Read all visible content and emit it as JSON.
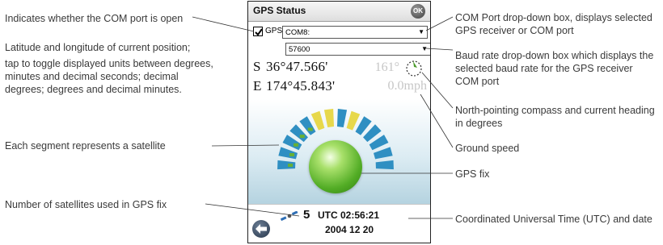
{
  "device": {
    "title": "GPS Status",
    "ok_label": "OK",
    "gps_checkbox_label": "GPS",
    "gps_checked": true,
    "com_port": "COM8:",
    "baud_rate": "57600",
    "latitude": {
      "hemisphere": "S",
      "value": "36°47.566'"
    },
    "longitude": {
      "hemisphere": "E",
      "value": "174°45.843'"
    },
    "heading": "161°",
    "speed": "0.0mph",
    "satellites_used": "5",
    "utc_time": "UTC 02:56:21",
    "utc_date": "2004 12 20",
    "colors": {
      "accent_blue": "#2f8fc2",
      "signal_yellow": "#e7d84b",
      "signal_green": "#67b035",
      "fix_green": "#52ac25"
    }
  },
  "annotations": {
    "com_open": "Indicates whether the COM port is open",
    "lat_lon": "Latitude and longitude of current position;",
    "toggle_units": "tap to toggle displayed units between degrees, minutes and decimal seconds; decimal degrees; degrees and decimal minutes.",
    "segment": "Each segment represents a satellite",
    "satellites_used": "Number of satellites used in GPS fix",
    "com_dropdown": "COM Port drop-down box, displays selected GPS receiver or COM port",
    "baud_dropdown": "Baud rate drop-down box which displays the selected baud rate for the GPS receiver COM port",
    "compass": "North-pointing compass and current heading in degrees",
    "ground_speed": "Ground speed",
    "gps_fix": "GPS fix",
    "utc": "Coordinated Universal Time (UTC) and date"
  }
}
